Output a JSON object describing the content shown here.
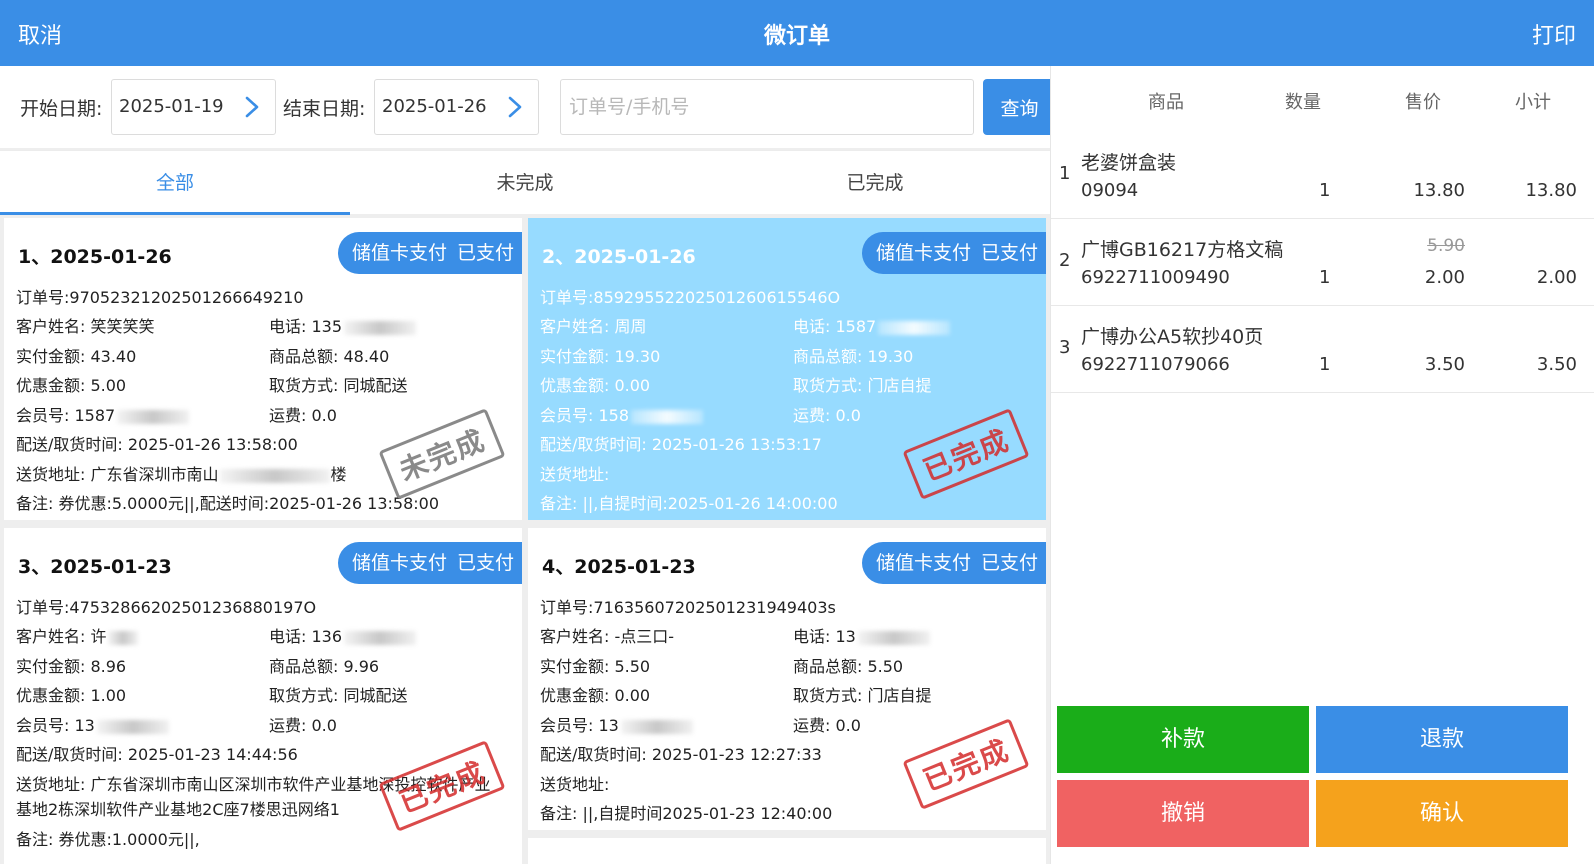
{
  "header": {
    "cancel_label": "取消",
    "title": "微订单",
    "print_label": "打印",
    "bg_color": "#3a8ee6"
  },
  "filter": {
    "start_label": "开始日期:",
    "start_value": "2025-01-19",
    "end_label": "结束日期:",
    "end_value": "2025-01-26",
    "search_placeholder": "订单号/手机号",
    "query_label": "查询",
    "chevron_icon": "chevron-right-icon"
  },
  "tabs": [
    {
      "label": "全部",
      "active": true
    },
    {
      "label": "未完成",
      "active": false
    },
    {
      "label": "已完成",
      "active": false
    }
  ],
  "orders": [
    {
      "header": "1、2025-01-26",
      "pay_method": "储值卡支付",
      "pay_status": "已支付",
      "order_no": "订单号:97052321202501266649210",
      "customer": "客户姓名: 笑笑笑笑",
      "phone": "电话: 135",
      "paid": "实付金额: 43.40",
      "total": "商品总额: 48.40",
      "discount": "优惠金额: 5.00",
      "pickup": "取货方式: 同城配送",
      "member": "会员号: 1587",
      "shipping": "运费: 0.0",
      "time": "配送/取货时间: 2025-01-26 13:58:00",
      "address": "送货地址: 广东省深圳市南山",
      "address2": "楼",
      "address3": "",
      "note": "备注: 券优惠:5.0000元||,配送时间:2025-01-26 13:58:00",
      "stamp": "未完成",
      "selected": false
    },
    {
      "header": "2、2025-01-26",
      "pay_method": "储值卡支付",
      "pay_status": "已支付",
      "order_no": "订单号:85929552202501260615546O",
      "customer": "客户姓名: 周周",
      "phone": "电话: 1587",
      "paid": "实付金额: 19.30",
      "total": "商品总额: 19.30",
      "discount": "优惠金额: 0.00",
      "pickup": "取货方式: 门店自提",
      "member": "会员号: 158",
      "shipping": "运费: 0.0",
      "time": "配送/取货时间: 2025-01-26 13:53:17",
      "address": "送货地址:",
      "address2": "",
      "address3": "",
      "note": "备注: ||,自提时间:2025-01-26 14:00:00",
      "stamp": "已完成",
      "selected": true
    },
    {
      "header": "3、2025-01-23",
      "pay_method": "储值卡支付",
      "pay_status": "已支付",
      "order_no": "订单号:47532866202501236880197O",
      "customer": "客户姓名: 许",
      "phone": "电话: 136",
      "paid": "实付金额: 8.96",
      "total": "商品总额: 9.96",
      "discount": "优惠金额: 1.00",
      "pickup": "取货方式: 同城配送",
      "member": "会员号: 13",
      "shipping": "运费: 0.0",
      "time": "配送/取货时间: 2025-01-23 14:44:56",
      "address": "送货地址: 广东省深圳市南山区深圳市软件产业基地深投控软件产业",
      "address2": "",
      "address3": "基地2栋深圳软件产业基地2C座7楼思迅网络1",
      "note": "备注: 券优惠:1.0000元||,",
      "stamp": "已完成",
      "selected": false
    },
    {
      "header": "4、2025-01-23",
      "pay_method": "储值卡支付",
      "pay_status": "已支付",
      "order_no": "订单号:71635607202501231949403s",
      "customer": "客户姓名: -点三口-",
      "phone": "电话: 13",
      "paid": "实付金额: 5.50",
      "total": "商品总额: 5.50",
      "discount": "优惠金额: 0.00",
      "pickup": "取货方式: 门店自提",
      "member": "会员号: 13",
      "shipping": "运费: 0.0",
      "time": "配送/取货时间: 2025-01-23 12:27:33",
      "address": "送货地址:",
      "address2": "",
      "address3": "",
      "note": "备注: ||,自提时间2025-01-23 12:40:00",
      "stamp": "已完成",
      "selected": false
    }
  ],
  "detail": {
    "columns": [
      "商品",
      "数量",
      "售价",
      "小计"
    ],
    "items": [
      {
        "index": "1",
        "name": "老婆饼盒装",
        "code": "09094",
        "qty": "1",
        "original_price": "",
        "price": "13.80",
        "subtotal": "13.80"
      },
      {
        "index": "2",
        "name": "广博GB16217方格文稿",
        "code": "6922711009490",
        "qty": "1",
        "original_price": "5.90",
        "price": "2.00",
        "subtotal": "2.00"
      },
      {
        "index": "3",
        "name": "广博办公A5软抄40页",
        "code": "6922711079066",
        "qty": "1",
        "original_price": "",
        "price": "3.50",
        "subtotal": "3.50"
      }
    ]
  },
  "actions": {
    "supplement_label": "补款",
    "refund_label": "退款",
    "revoke_label": "撤销",
    "confirm_label": "确认",
    "supplement_color": "#1aad19",
    "refund_color": "#3a8ee6",
    "revoke_color": "#f06262",
    "confirm_color": "#f5a21c"
  }
}
